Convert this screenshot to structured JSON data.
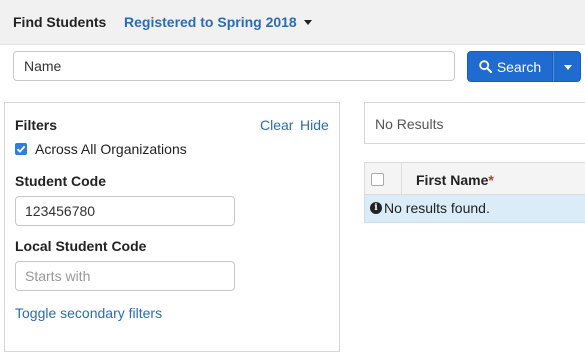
{
  "header": {
    "title": "Find Students",
    "registration_filter": "Registered to Spring 2018"
  },
  "search": {
    "value": "Name",
    "button_label": "Search"
  },
  "filters": {
    "title": "Filters",
    "clear_label": "Clear",
    "hide_label": "Hide",
    "across_orgs_label": "Across All Organizations",
    "across_orgs_checked": true,
    "student_code_label": "Student Code",
    "student_code_value": "123456780",
    "local_code_label": "Local Student Code",
    "local_code_placeholder": "Starts with",
    "toggle_label": "Toggle secondary filters"
  },
  "results": {
    "status": "No Results",
    "columns": [
      {
        "label": "First Name",
        "required_marker": "*"
      }
    ],
    "empty_message": "No results found."
  },
  "colors": {
    "accent": "#2a6db5",
    "button": "#1f6bd0",
    "empty_row": "#d9ecf7"
  }
}
